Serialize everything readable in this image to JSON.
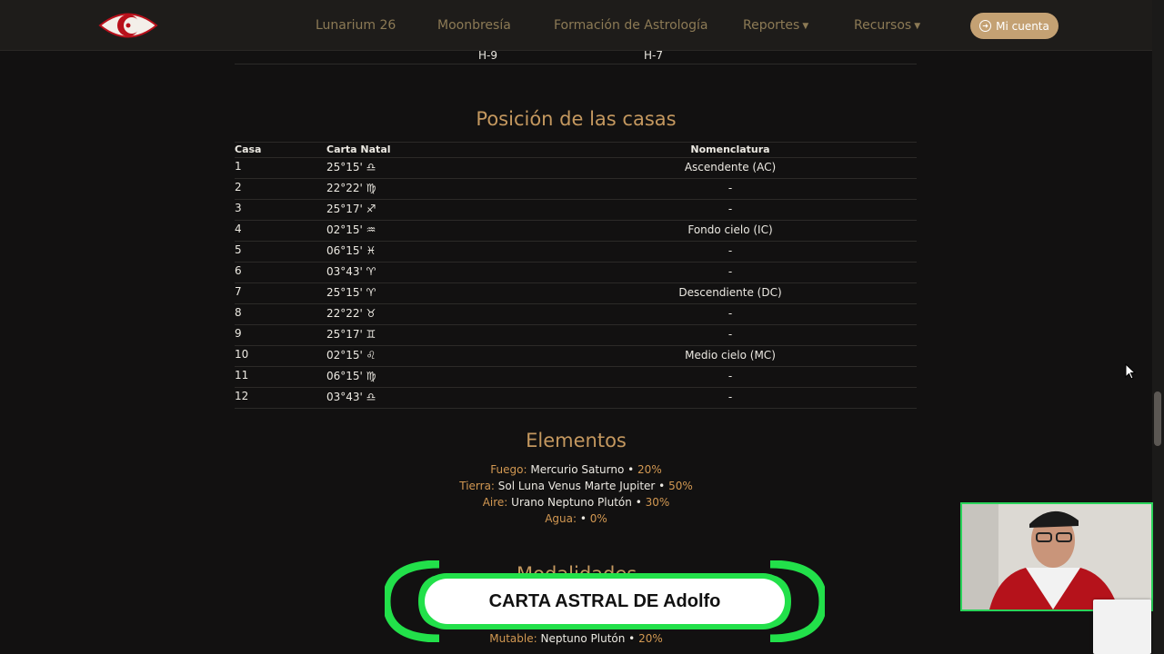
{
  "nav": {
    "items": [
      {
        "label": "Lunarium 26",
        "dropdown": false
      },
      {
        "label": "Moonbresía",
        "dropdown": false
      },
      {
        "label": "Formación de Astrología",
        "dropdown": false
      },
      {
        "label": "Reportes",
        "dropdown": true
      },
      {
        "label": "Recursos",
        "dropdown": true
      }
    ],
    "account_label": "Mi cuenta"
  },
  "prev_table": {
    "cells": [
      "H-9",
      "H-7"
    ]
  },
  "houses": {
    "title": "Posición de las casas",
    "headers": [
      "Casa",
      "Carta Natal",
      "Nomenclatura"
    ],
    "rows": [
      {
        "casa": "1",
        "natal": "25°15' ♎",
        "nom": "Ascendente (AC)"
      },
      {
        "casa": "2",
        "natal": "22°22' ♍",
        "nom": "-"
      },
      {
        "casa": "3",
        "natal": "25°17' ♐",
        "nom": "-"
      },
      {
        "casa": "4",
        "natal": "02°15' ♒",
        "nom": "Fondo cielo (IC)"
      },
      {
        "casa": "5",
        "natal": "06°15' ♓",
        "nom": "-"
      },
      {
        "casa": "6",
        "natal": "03°43' ♈",
        "nom": "-"
      },
      {
        "casa": "7",
        "natal": "25°15' ♈",
        "nom": "Descendiente (DC)"
      },
      {
        "casa": "8",
        "natal": "22°22' ♉",
        "nom": "-"
      },
      {
        "casa": "9",
        "natal": "25°17' ♊",
        "nom": "-"
      },
      {
        "casa": "10",
        "natal": "02°15' ♌",
        "nom": "Medio cielo (MC)"
      },
      {
        "casa": "11",
        "natal": "06°15' ♍",
        "nom": "-"
      },
      {
        "casa": "12",
        "natal": "03°43' ♎",
        "nom": "-"
      }
    ]
  },
  "elements": {
    "title": "Elementos",
    "items": [
      {
        "label": "Fuego:",
        "planets": "Mercurio Saturno",
        "pct": "20%"
      },
      {
        "label": "Tierra:",
        "planets": "Sol Luna Venus Marte Jupiter",
        "pct": "50%"
      },
      {
        "label": "Aire:",
        "planets": "Urano Neptuno Plutón",
        "pct": "30%"
      },
      {
        "label": "Agua:",
        "planets": "",
        "pct": "0%"
      }
    ]
  },
  "modalities": {
    "title_partial": "Modalidades",
    "items": [
      {
        "label": "Mutable:",
        "planets": "Neptuno Plutón",
        "pct": "20%"
      }
    ]
  },
  "overlay": {
    "banner_text": "CARTA ASTRAL DE Adolfo"
  },
  "colors": {
    "accent": "#c4985f",
    "button": "#c4a173",
    "label": "#d29852",
    "banner_green": "#22e04a"
  }
}
